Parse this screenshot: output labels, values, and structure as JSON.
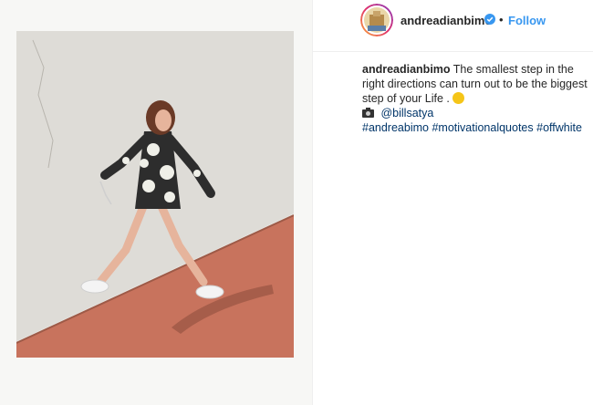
{
  "post": {
    "image_alt": "Woman in floral dress walking past a white wall on a terracotta floor"
  },
  "header": {
    "username": "andreadianbimo",
    "verified": true,
    "separator": "•",
    "follow_label": "Follow"
  },
  "caption": {
    "username": "andreadianbimo",
    "text": "The smallest step in the right directions can turn out to be the biggest step of your Life .",
    "credit": "@billsatya",
    "hashtags": [
      "#andreabimo",
      "#motivationalquotes",
      "#offwhite"
    ]
  },
  "colors": {
    "follow": "#3897f0",
    "link": "#003569",
    "verified": "#3897f0",
    "floor": "#c9745f",
    "wall": "#e4e3df"
  }
}
